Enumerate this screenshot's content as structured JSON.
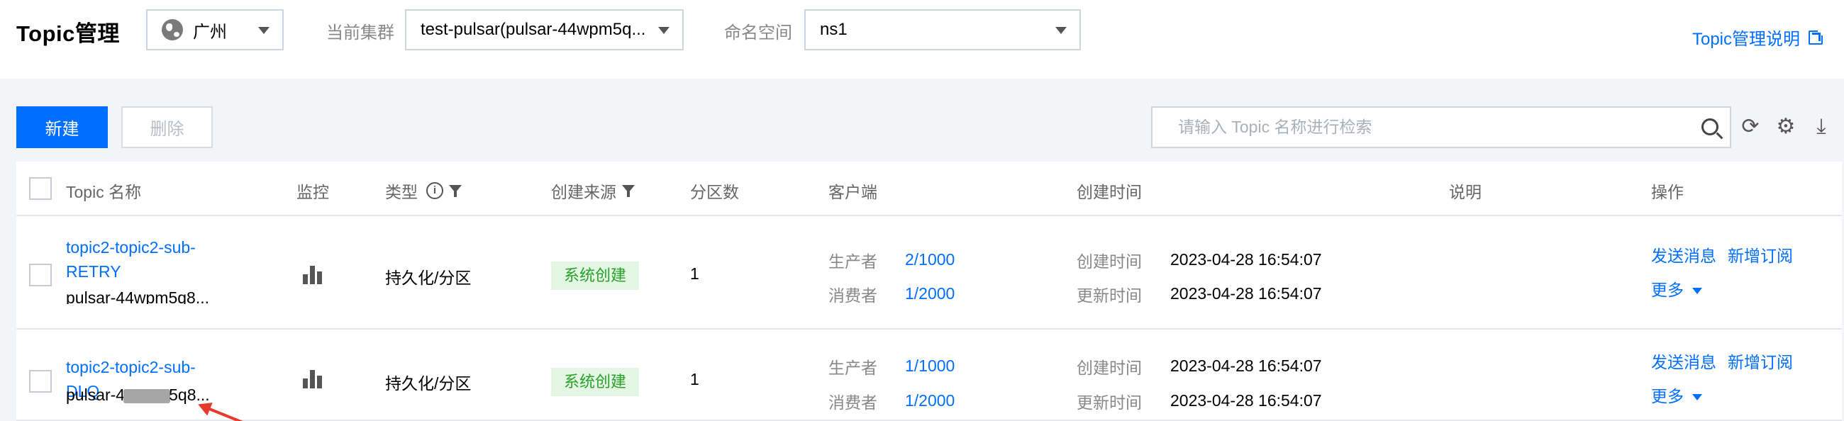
{
  "header": {
    "title": "Topic管理",
    "region": "广州",
    "cluster_label": "当前集群",
    "cluster_value": "test-pulsar(pulsar-44wpm5q...",
    "namespace_label": "命名空间",
    "namespace_value": "ns1",
    "help_link": "Topic管理说明"
  },
  "toolbar": {
    "new_label": "新建",
    "delete_label": "删除",
    "search_placeholder": "请输入 Topic 名称进行检索"
  },
  "table": {
    "columns": [
      "Topic 名称",
      "监控",
      "类型",
      "创建来源",
      "分区数",
      "客户端",
      "创建时间",
      "说明",
      "操作"
    ],
    "rows": [
      {
        "name": "topic2-topic2-sub-RETRY",
        "sub": "pulsar-44wpm5q8...",
        "type": "持久化/分区",
        "source": "系统创建",
        "partitions": "1",
        "producer_label": "生产者",
        "producer": "2/1000",
        "consumer_label": "消费者",
        "consumer": "1/2000",
        "created_label": "创建时间",
        "created": "2023-04-28 16:54:07",
        "updated_label": "更新时间",
        "updated": "2023-04-28 16:54:07",
        "action_send": "发送消息",
        "action_subscribe": "新增订阅",
        "action_more": "更多"
      },
      {
        "name": "topic2-topic2-sub-DLQ",
        "sub_prefix": "pulsar-4",
        "sub_suffix": "5q8...",
        "type": "持久化/分区",
        "source": "系统创建",
        "partitions": "1",
        "producer_label": "生产者",
        "producer": "1/1000",
        "consumer_label": "消费者",
        "consumer": "1/2000",
        "created_label": "创建时间",
        "created": "2023-04-28 16:54:07",
        "updated_label": "更新时间",
        "updated": "2023-04-28 16:54:07",
        "action_send": "发送消息",
        "action_subscribe": "新增订阅",
        "action_more": "更多"
      }
    ]
  },
  "icons": {
    "refresh": "refresh-icon",
    "settings": "gear-icon",
    "download": "download-icon"
  },
  "colors": {
    "primary": "#006eff",
    "tag_bg": "#e4f6e4",
    "tag_text": "#27a127",
    "annotation": "#e53a2c"
  }
}
